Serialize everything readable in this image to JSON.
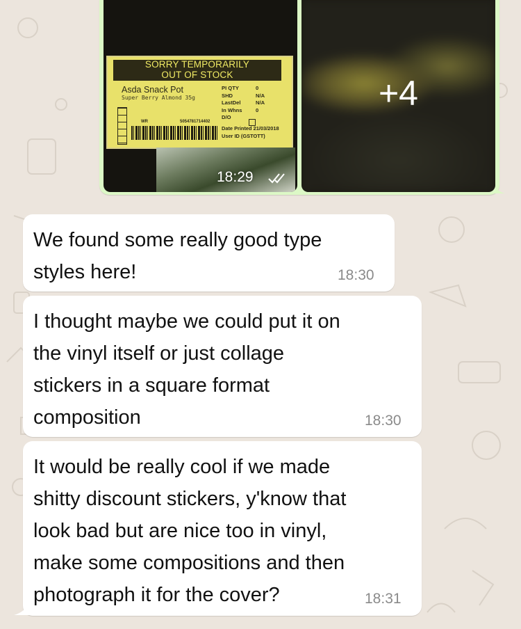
{
  "photo_message": {
    "label": {
      "header_line1": "SORRY TEMPORARILY",
      "header_line2": "OUT OF STOCK",
      "product": "Asda Snack Pot",
      "variant": "Super Berry Almond 35g",
      "fields": [
        "PI QTY",
        "SHD",
        "LastDel",
        "In Whns",
        "D/O"
      ],
      "values": [
        "0",
        "N/A",
        "N/A",
        "0"
      ],
      "date_printed": "Date Printed 21/03/2018",
      "user_id": "User ID      (GSTOTT)",
      "wr": "WR",
      "code": "5054781714402"
    },
    "more_count": "+4",
    "time": "18:29",
    "status": "read",
    "bubble_color": "#dcf8c6"
  },
  "messages": [
    {
      "lines": [
        "We found some really good type",
        "styles here!"
      ],
      "time": "18:30"
    },
    {
      "lines": [
        "I thought maybe we could put it on",
        "the vinyl itself or just collage",
        "stickers in a square format",
        "composition"
      ],
      "time": "18:30"
    },
    {
      "lines": [
        "It would be really cool if we made",
        "shitty discount stickers, y'know that",
        "look bad but are nice too in vinyl,",
        "make some compositions and then",
        "photograph it for the cover?"
      ],
      "time": "18:31"
    }
  ],
  "colors": {
    "wallpaper": "#ece5dd",
    "incoming_bubble": "#ffffff",
    "outgoing_bubble": "#dcf8c6",
    "timestamp": "#8a8a8a"
  }
}
